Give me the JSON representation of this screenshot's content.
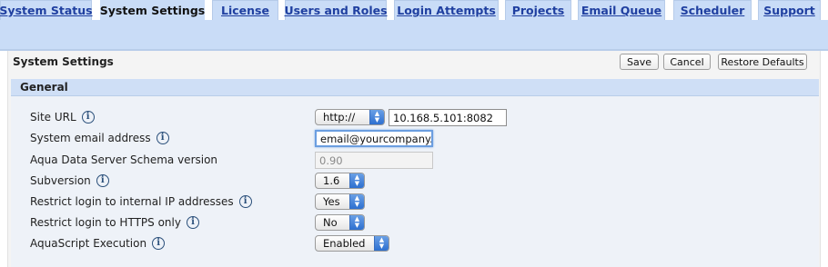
{
  "tabs": [
    {
      "label": "System Status",
      "active": false
    },
    {
      "label": "System Settings",
      "active": true
    },
    {
      "label": "License",
      "active": false
    },
    {
      "label": "Users and Roles",
      "active": false
    },
    {
      "label": "Login Attempts",
      "active": false
    },
    {
      "label": "Projects",
      "active": false
    },
    {
      "label": "Email Queue",
      "active": false
    },
    {
      "label": "Scheduler",
      "active": false
    },
    {
      "label": "Support",
      "active": false
    }
  ],
  "panel": {
    "title": "System Settings",
    "save_label": "Save",
    "cancel_label": "Cancel",
    "restore_label": "Restore Defaults"
  },
  "section": {
    "title": "General",
    "rows": [
      {
        "label": "Site URL",
        "protocol": "http://",
        "value": "10.168.5.101:8082"
      },
      {
        "label": "System email address",
        "value": "email@yourcompany.con"
      },
      {
        "label": "Aqua Data Server Schema version",
        "value": "0.90"
      },
      {
        "label": "Subversion",
        "value": "1.6"
      },
      {
        "label": "Restrict login to internal IP addresses",
        "value": "Yes"
      },
      {
        "label": "Restrict login to HTTPS only",
        "value": "No"
      },
      {
        "label": "AquaScript Execution",
        "value": "Enabled"
      }
    ]
  },
  "icons": {
    "info": "info-icon",
    "select_arrows": "select-arrows-icon"
  },
  "colors": {
    "tab_bg": "#c9dcf7",
    "link": "#1f3fa0",
    "section_bg": "#cfdff6"
  }
}
